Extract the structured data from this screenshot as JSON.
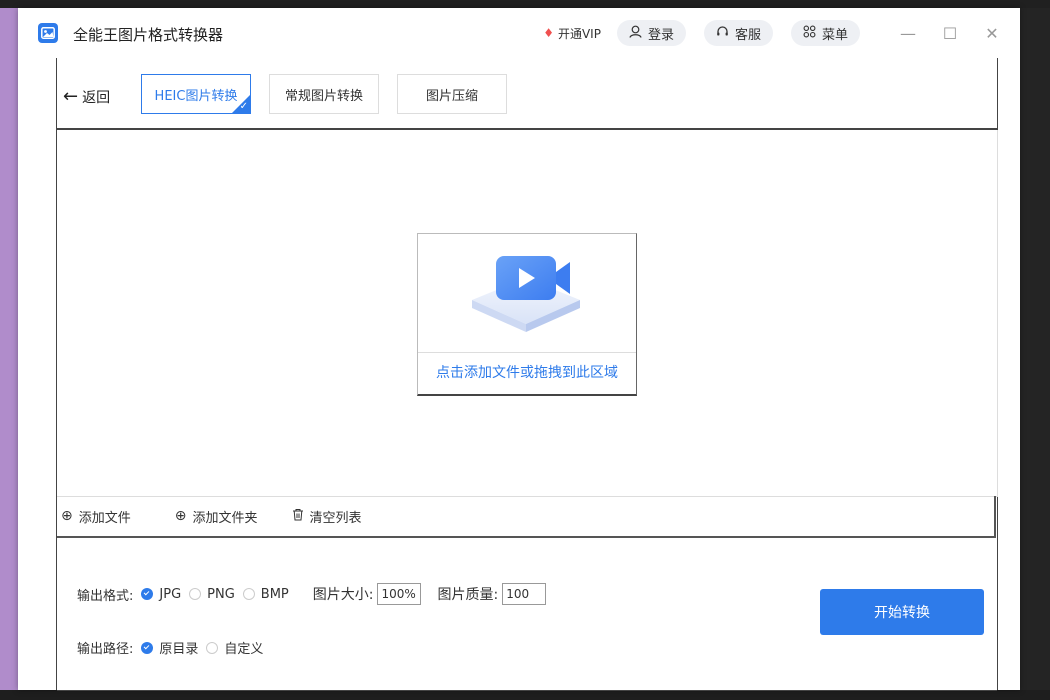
{
  "window": {
    "title": "全能王图片格式转换器",
    "vip_label": "开通VIP",
    "login_label": "登录",
    "service_label": "客服",
    "menu_label": "菜单"
  },
  "nav": {
    "back_label": "返回",
    "tabs": [
      {
        "label": "HEIC图片转换",
        "active": true
      },
      {
        "label": "常规图片转换",
        "active": false
      },
      {
        "label": "图片压缩",
        "active": false
      }
    ]
  },
  "dropzone": {
    "hint": "点击添加文件或拖拽到此区域"
  },
  "actions": {
    "add_file": "添加文件",
    "add_folder": "添加文件夹",
    "clear_list": "清空列表"
  },
  "settings": {
    "format_label": "输出格式:",
    "formats": [
      {
        "label": "JPG",
        "selected": true
      },
      {
        "label": "PNG",
        "selected": false
      },
      {
        "label": "BMP",
        "selected": false
      }
    ],
    "size_label": "图片大小:",
    "size_value": "100%",
    "quality_label": "图片质量:",
    "quality_value": "100",
    "path_label": "输出路径:",
    "paths": [
      {
        "label": "原目录",
        "selected": true
      },
      {
        "label": "自定义",
        "selected": false
      }
    ],
    "start_label": "开始转换"
  },
  "colors": {
    "accent": "#2e7bea",
    "vip_gem": "#f0504f"
  }
}
